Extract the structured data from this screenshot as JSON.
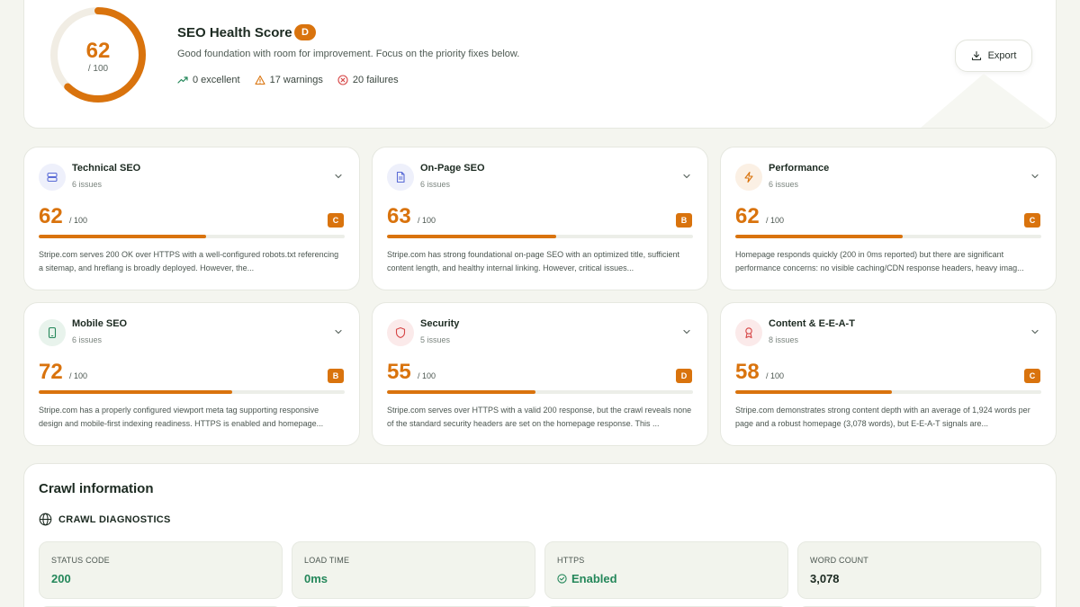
{
  "hero": {
    "score": "62",
    "score_denominator": "/ 100",
    "score_fraction": 0.62,
    "title": "SEO Health Score",
    "grade": "D",
    "subtitle": "Good foundation with room for improvement. Focus on the priority fixes below.",
    "stats": {
      "excellent": "0 excellent",
      "warnings": "17 warnings",
      "failures": "20 failures"
    },
    "export_label": "Export",
    "colors": {
      "accent": "#d9730d",
      "ring_track": "#f1ede4",
      "excellent": "#24875a",
      "warning": "#d9730d",
      "failure": "#d64545"
    }
  },
  "categories": [
    {
      "title": "Technical SEO",
      "issues": "6 issues",
      "score": "62",
      "denominator": "/ 100",
      "grade": "C",
      "progress": 0.62,
      "icon": "server-icon",
      "icon_color": "#5b6cd6",
      "icon_bg": "#eef0fb",
      "description": "Stripe.com serves 200 OK over HTTPS with a well-configured robots.txt referencing a sitemap, and hreflang is broadly deployed. However, the..."
    },
    {
      "title": "On-Page SEO",
      "issues": "6 issues",
      "score": "63",
      "denominator": "/ 100",
      "grade": "B",
      "progress": 0.63,
      "icon": "document-icon",
      "icon_color": "#5b6cd6",
      "icon_bg": "#eef0fb",
      "description": "Stripe.com has strong foundational on-page SEO with an optimized title, sufficient content length, and healthy internal linking. However, critical issues..."
    },
    {
      "title": "Performance",
      "issues": "6 issues",
      "score": "62",
      "denominator": "/ 100",
      "grade": "C",
      "progress": 0.62,
      "icon": "lightning-icon",
      "icon_color": "#d9730d",
      "icon_bg": "#fbf0e4",
      "description": "Homepage responds quickly (200 in 0ms reported) but there are significant performance concerns: no visible caching/CDN response headers, heavy imag..."
    },
    {
      "title": "Mobile SEO",
      "issues": "6 issues",
      "score": "72",
      "denominator": "/ 100",
      "grade": "B",
      "progress": 0.72,
      "icon": "mobile-icon",
      "icon_color": "#24875a",
      "icon_bg": "#e8f3ec",
      "description": "Stripe.com has a properly configured viewport meta tag supporting responsive design and mobile-first indexing readiness. HTTPS is enabled and homepage..."
    },
    {
      "title": "Security",
      "issues": "5 issues",
      "score": "55",
      "denominator": "/ 100",
      "grade": "D",
      "progress": 0.55,
      "icon": "shield-icon",
      "icon_color": "#d64545",
      "icon_bg": "#fbeaea",
      "description": "Stripe.com serves over HTTPS with a valid 200 response, but the crawl reveals none of the standard security headers are set on the homepage response. This ..."
    },
    {
      "title": "Content & E-E-A-T",
      "issues": "8 issues",
      "score": "58",
      "denominator": "/ 100",
      "grade": "C",
      "progress": 0.58,
      "icon": "award-icon",
      "icon_color": "#d64545",
      "icon_bg": "#fbeaea",
      "description": "Stripe.com demonstrates strong content depth with an average of 1,924 words per page and a robust homepage (3,078 words), but E-E-A-T signals are..."
    }
  ],
  "crawl": {
    "title": "Crawl information",
    "subtitle": "CRAWL DIAGNOSTICS",
    "metrics": [
      {
        "label": "STATUS CODE",
        "value": "200",
        "tone": "green"
      },
      {
        "label": "LOAD TIME",
        "value": "0ms",
        "tone": "green"
      },
      {
        "label": "HTTPS",
        "value": "Enabled",
        "tone": "green",
        "icon": "check-circle-icon"
      },
      {
        "label": "WORD COUNT",
        "value": "3,078",
        "tone": "default"
      }
    ]
  }
}
